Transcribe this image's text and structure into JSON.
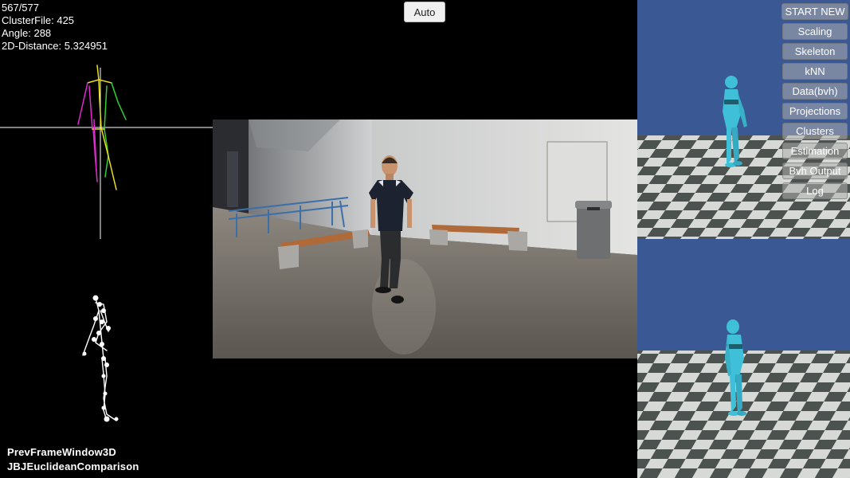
{
  "stats": {
    "frame": "567/577",
    "cluster_file": "ClusterFile: 425",
    "angle": "Angle: 288",
    "distance": "2D-Distance: 5.324951"
  },
  "auto_label": "Auto",
  "menu": [
    "START NEW",
    "Scaling",
    "Skeleton",
    "kNN",
    "Data(bvh)",
    "Projections",
    "Clusters",
    "Estimation",
    "Bvh Output",
    "Log"
  ],
  "bottom_labels": {
    "line1": "PrevFrameWindow3D",
    "line2": "JBJEuclideanComparison"
  },
  "colors": {
    "sky": "#3a5894",
    "checker_light": "#d6d9d6",
    "checker_dark": "#4c524f",
    "avatar": "#3fc0d8",
    "skeleton_left": "#e02ad0",
    "skeleton_right": "#2fd22f",
    "skeleton_mid": "#e8e020"
  }
}
